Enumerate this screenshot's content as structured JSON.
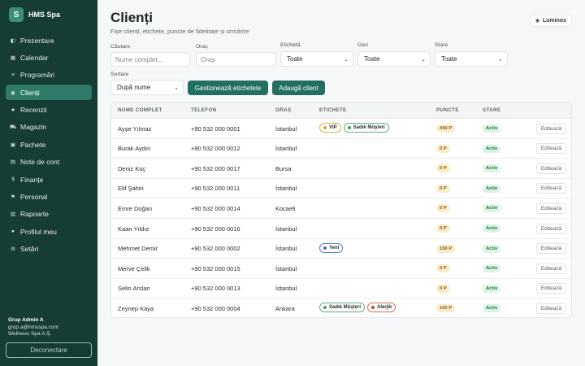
{
  "brand": {
    "logo_letter": "S",
    "name": "HMS Spa"
  },
  "sidebar": {
    "items": [
      {
        "label": "Prezentare",
        "icon": "dashboard-icon",
        "glyph": "◧",
        "active": false
      },
      {
        "label": "Calendar",
        "icon": "calendar-icon",
        "glyph": "▦",
        "active": false
      },
      {
        "label": "Programări",
        "icon": "list-icon",
        "glyph": "≡",
        "active": false
      },
      {
        "label": "Clienți",
        "icon": "users-icon",
        "glyph": "◉",
        "active": true
      },
      {
        "label": "Recenzii",
        "icon": "star-icon",
        "glyph": "★",
        "active": false
      },
      {
        "label": "Magazin",
        "icon": "cart-icon",
        "glyph": "⛟",
        "active": false
      },
      {
        "label": "Pachete",
        "icon": "package-icon",
        "glyph": "▣",
        "active": false
      },
      {
        "label": "Note de cont",
        "icon": "receipt-icon",
        "glyph": "▤",
        "active": false
      },
      {
        "label": "Finanțe",
        "icon": "money-bag-icon",
        "glyph": "$",
        "active": false
      },
      {
        "label": "Personal",
        "icon": "flag-icon",
        "glyph": "⚑",
        "active": false
      },
      {
        "label": "Rapoarte",
        "icon": "bar-chart-icon",
        "glyph": "▥",
        "active": false
      },
      {
        "label": "Profilul meu",
        "icon": "profile-icon",
        "glyph": "●",
        "active": false
      },
      {
        "label": "Setări",
        "icon": "gear-icon",
        "glyph": "⚙",
        "active": false
      }
    ],
    "user": {
      "name": "Grup Admin A",
      "email": "grup.a@hmsspa.com",
      "org": "Wellness Spa A.Ș."
    },
    "logout_label": "Deconectare"
  },
  "header": {
    "title": "Clienți",
    "subtitle": "Fișe clienți, etichete, puncte de fidelitate și urmărire",
    "theme_label": "Luminos",
    "theme_glyph": "☀"
  },
  "filters": {
    "search": {
      "label": "Căutare",
      "placeholder": "Nume complet..."
    },
    "city": {
      "label": "Oraș",
      "placeholder": "Oraș"
    },
    "tag": {
      "label": "Etichetă",
      "value": "Toate"
    },
    "gender": {
      "label": "Gen",
      "value": "Toate"
    },
    "status": {
      "label": "Stare",
      "value": "Toate"
    },
    "sort": {
      "label": "Sortare",
      "value": "După nume"
    },
    "manage_tags_label": "Gestionează etichetele",
    "add_client_label": "Adaugă client"
  },
  "table": {
    "columns": [
      "NUME COMPLET",
      "TELEFON",
      "ORAȘ",
      "ETICHETE",
      "PUNCTE",
      "STARE"
    ],
    "edit_label": "Editează",
    "rows": [
      {
        "name": "Ayşe Yılmaz",
        "phone": "+90 532 000 0001",
        "city": "İstanbul",
        "tags": [
          {
            "label": "VIP",
            "kind": "vip"
          },
          {
            "label": "Sadık Müşteri",
            "kind": "sadik"
          }
        ],
        "points": "440 P",
        "status": "Activ"
      },
      {
        "name": "Burak Aydın",
        "phone": "+90 532 000 0012",
        "city": "İstanbul",
        "tags": [],
        "points": "0 P",
        "status": "Activ"
      },
      {
        "name": "Deniz Koç",
        "phone": "+90 532 000 0017",
        "city": "Bursa",
        "tags": [],
        "points": "0 P",
        "status": "Activ"
      },
      {
        "name": "Elif Şahin",
        "phone": "+90 532 000 0011",
        "city": "İstanbul",
        "tags": [],
        "points": "0 P",
        "status": "Activ"
      },
      {
        "name": "Emre Doğan",
        "phone": "+90 532 000 0014",
        "city": "Kocaeli",
        "tags": [],
        "points": "0 P",
        "status": "Activ"
      },
      {
        "name": "Kaan Yıldız",
        "phone": "+90 532 000 0016",
        "city": "İstanbul",
        "tags": [],
        "points": "0 P",
        "status": "Activ"
      },
      {
        "name": "Mehmet Demir",
        "phone": "+90 532 000 0002",
        "city": "İstanbul",
        "tags": [
          {
            "label": "Yeni",
            "kind": "yeni"
          }
        ],
        "points": "150 P",
        "status": "Activ"
      },
      {
        "name": "Merve Çelik",
        "phone": "+90 532 000 0015",
        "city": "İstanbul",
        "tags": [],
        "points": "0 P",
        "status": "Activ"
      },
      {
        "name": "Selin Arslan",
        "phone": "+90 532 000 0013",
        "city": "İstanbul",
        "tags": [],
        "points": "0 P",
        "status": "Activ"
      },
      {
        "name": "Zeynep Kaya",
        "phone": "+90 532 000 0004",
        "city": "Ankara",
        "tags": [
          {
            "label": "Sadık Müşteri",
            "kind": "sadik"
          },
          {
            "label": "Alerjik",
            "kind": "alerjik"
          }
        ],
        "points": "100 P",
        "status": "Activ"
      }
    ]
  }
}
